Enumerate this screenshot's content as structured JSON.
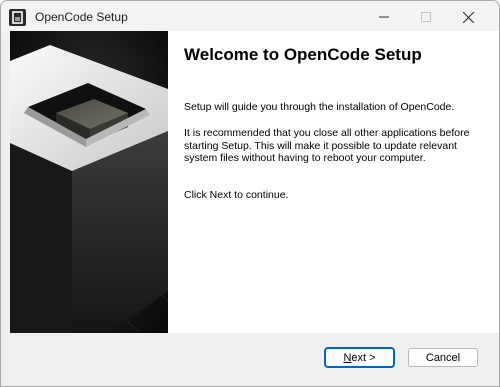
{
  "window": {
    "title": "OpenCode Setup",
    "icon": "app-icon"
  },
  "controls": {
    "minimize_icon": "minimize-icon",
    "maximize_icon": "maximize-icon",
    "close_icon": "close-icon"
  },
  "welcome": {
    "title": "Welcome to OpenCode Setup",
    "para1": "Setup will guide you through the installation of OpenCode.",
    "para2": "It is recommended that you close all other applications before starting Setup. This will make it possible to update relevant system files without having to reboot your computer.",
    "para3": "Click Next to continue."
  },
  "buttons": {
    "next_label": "Next >",
    "cancel_label": "Cancel"
  },
  "colors": {
    "accent": "#0067c0",
    "banner_dark": "#111111"
  }
}
